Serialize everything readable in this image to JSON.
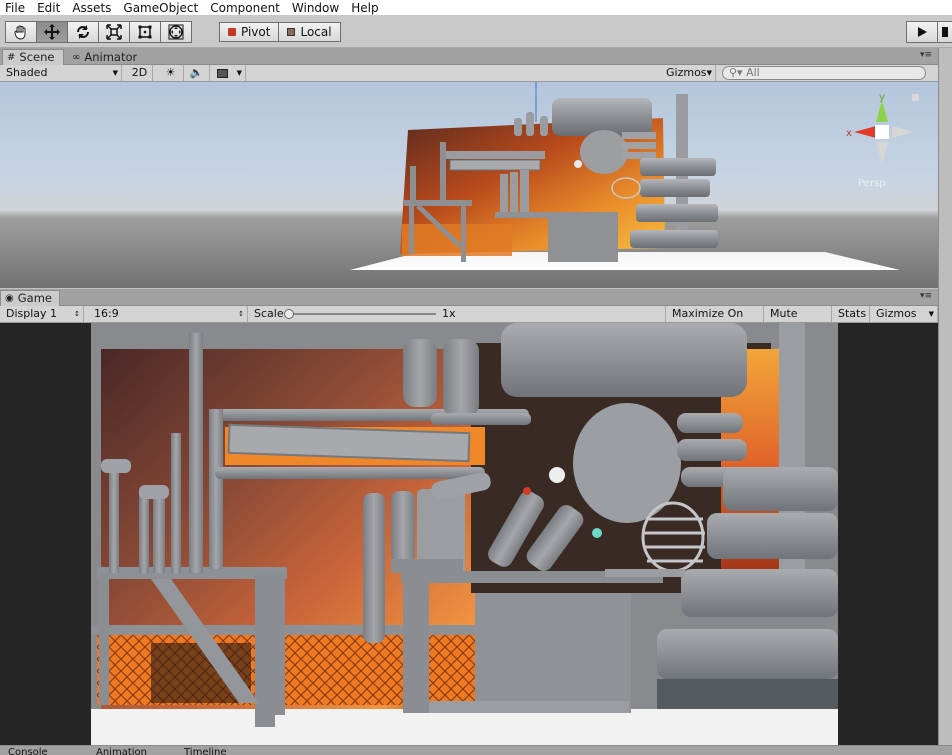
{
  "menu": [
    "File",
    "Edit",
    "Assets",
    "GameObject",
    "Component",
    "Window",
    "Help"
  ],
  "toolbar": {
    "tools": [
      "hand-tool",
      "move-tool",
      "rotate-tool",
      "scale-tool",
      "rect-tool",
      "transform-tool"
    ],
    "active_tool": "move-tool",
    "pivot_label": "Pivot",
    "local_label": "Local"
  },
  "scene_tabs": [
    {
      "label": "Scene",
      "icon": "scene-icon",
      "active": true
    },
    {
      "label": "Animator",
      "icon": "animator-icon",
      "active": false
    }
  ],
  "scene_controls": {
    "shading_mode": "Shaded",
    "mode_2d": "2D",
    "gizmos_label": "Gizmos",
    "search_placeholder": "All"
  },
  "scene_gizmo": {
    "axis_y": "y",
    "axis_x": "x",
    "projection_label": "Persp"
  },
  "game_tabs": [
    {
      "label": "Game",
      "icon": "game-icon",
      "active": true
    }
  ],
  "game_controls": {
    "display": "Display 1",
    "aspect": "16:9",
    "scale_label": "Scale",
    "scale_value": "1x",
    "maximize_on_play": "Maximize On Play",
    "mute_audio": "Mute Audio",
    "stats": "Stats",
    "gizmos": "Gizmos"
  },
  "bottom_tabs": [
    "Console",
    "Animation",
    "Timeline"
  ],
  "colors": {
    "axis_x": "#e03c28",
    "axis_y": "#8cd34a",
    "axis_z": "#3a7bd5",
    "selection": "#3a6fb0"
  }
}
